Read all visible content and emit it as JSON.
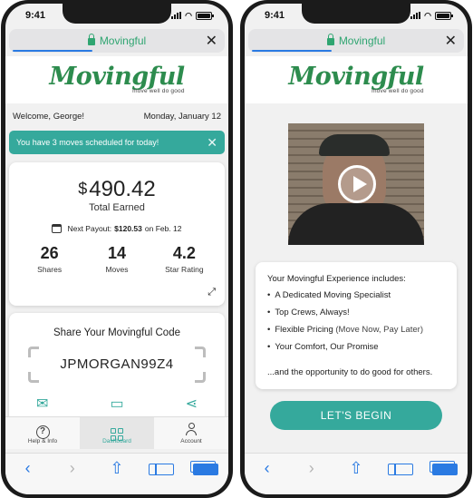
{
  "status": {
    "time": "9:41"
  },
  "browser": {
    "site": "Movingful",
    "close_icon": "close-icon"
  },
  "logo": {
    "wordmark": "Movingful",
    "tagline": "move well do good"
  },
  "dashboard": {
    "welcome": "Welcome, George!",
    "date": "Monday, January 12",
    "banner": "You have 3 moves scheduled for today!",
    "earnings": {
      "currency": "$",
      "amount": "490.42",
      "label": "Total Earned",
      "payout_prefix": "Next Payout:",
      "payout_amount": "$120.53",
      "payout_suffix": "on Feb. 12"
    },
    "stats": [
      {
        "value": "26",
        "label": "Shares"
      },
      {
        "value": "14",
        "label": "Moves"
      },
      {
        "value": "4.2",
        "label": "Star Rating"
      }
    ],
    "share": {
      "title": "Share Your Movingful Code",
      "code": "JPMORGAN99Z4"
    },
    "tabs": [
      {
        "label": "Help & Info",
        "icon": "help-icon"
      },
      {
        "label": "Dashboard",
        "icon": "grid-icon"
      },
      {
        "label": "Account",
        "icon": "person-icon"
      }
    ]
  },
  "intro": {
    "list_title": "Your Movingful Experience includes:",
    "items": [
      "A Dedicated Moving Specialist",
      "Top Crews, Always!",
      "Flexible Pricing",
      "Your Comfort, Our Promise"
    ],
    "flexible_note": "(Move Now, Pay Later)",
    "footer": "...and the opportunity to do good for others.",
    "cta": "LET'S BEGIN"
  },
  "colors": {
    "accent": "#35a99c",
    "brand_green": "#2d8c4e",
    "ios_blue": "#2a7ae2"
  }
}
